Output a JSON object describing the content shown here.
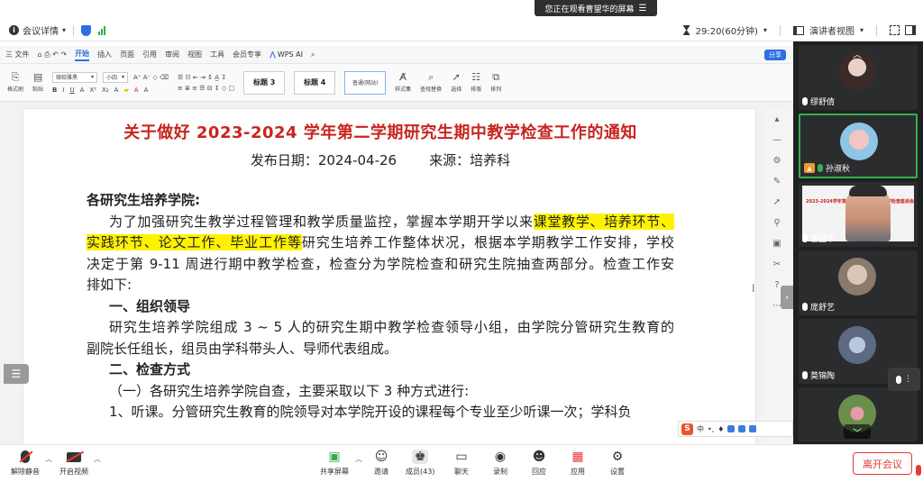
{
  "banner": {
    "text": "您正在观看曹望华的屏幕",
    "menu_glyph": "☰"
  },
  "topbar": {
    "meeting_details": "会议详情",
    "duration": "29:20(60分钟)",
    "view_mode": "演讲者视图"
  },
  "wps": {
    "menus": [
      "三 文件",
      "开始",
      "插入",
      "页面",
      "引用",
      "审阅",
      "视图",
      "工具",
      "会员专享"
    ],
    "active_menu": "开始",
    "wps_ai": "WPS AI",
    "share": "分享",
    "ribbon": {
      "format_painter": "格式刷",
      "paste": "粘贴",
      "font_name": "微软雅黑",
      "font_size": "小四",
      "style_h3": "标题 3",
      "style_h4": "标题 4",
      "style_normal": "普通(网站)",
      "styles_set": "样式集",
      "find_replace": "查找替换",
      "select": "选择",
      "sort": "排版",
      "arrange": "排列"
    }
  },
  "document": {
    "title": "关于做好 2023-2024 学年第二学期研究生期中教学检查工作的通知",
    "publish_label": "发布日期：",
    "publish_date": "2024-04-26",
    "source_label": "来源：",
    "source": "培养科",
    "salutation": "各研究生培养学院:",
    "para1_a": "为了加强研究生教学过程管理和教学质量监控，掌握本学期开学以来",
    "para1_hl1": "课堂教学、培养环节、",
    "para1_hl2": "实践环节、论文工作、毕业工作等",
    "para1_b": "研究生培养工作整体状况，根据本学期教学工作安排，学校",
    "para1_c": "决定于第 9-11 周进行期中教学检查，检查分为学院检查和研究生院抽查两部分。检查工作安",
    "para1_d": "排如下:",
    "h1": "一、组织领导",
    "para2_a": "研究生培养学院组成 3 ~ 5 人的研究生期中教学检查领导小组，由学院分管研究生教育的",
    "para2_b": "副院长任组长，组员由学科带头人、导师代表组成。",
    "h2": "二、检查方式",
    "para3": "（一）各研究生培养学院自查，主要采取以下 3 种方式进行:",
    "para4": "1、听课。分管研究生教育的院领导对本学院开设的课程每个专业至少听课一次；学科负"
  },
  "ime": {
    "logo": "S",
    "lang": "中"
  },
  "participants": [
    {
      "name": "缪舒倩",
      "mic": "white"
    },
    {
      "name": "孙淑秋",
      "mic": "green",
      "active": true
    },
    {
      "name": "曹望华",
      "mic": "white",
      "sharing": true
    },
    {
      "name": "庞舒艺",
      "mic": "white"
    },
    {
      "name": "莫锦陶",
      "mic": "white"
    },
    {
      "name": "",
      "mic": "white"
    }
  ],
  "thumb_text": "2023-2024学年第二学期研究生期中教学检查座谈会",
  "bottombar": {
    "unmute": "解除静音",
    "start_video": "开启视频",
    "share_screen": "共享屏幕",
    "invite": "邀请",
    "members": "成员(43)",
    "chat": "聊天",
    "record": "录制",
    "replay": "回应",
    "apps": "应用",
    "settings": "设置",
    "leave": "离开会议"
  },
  "colors": {
    "title_red": "#c8251e",
    "highlight": "#fff200",
    "accent_blue": "#2f6fe0",
    "active_green": "#32b24f",
    "leave_red": "#e53935"
  }
}
